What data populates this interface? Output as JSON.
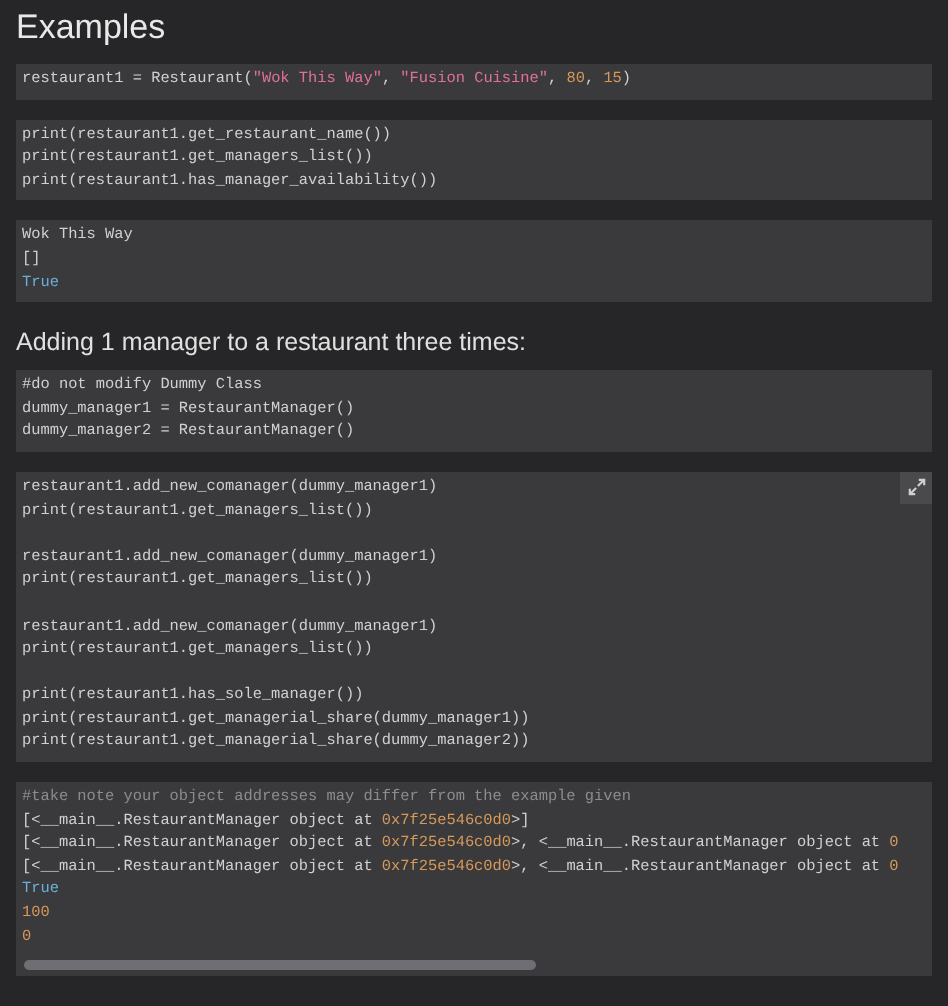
{
  "sections": [
    {
      "kind": "title",
      "text": "Examples"
    },
    {
      "kind": "code",
      "groups": [
        [
          [
            {
              "kind": "plain",
              "t": "restaurant1 = Restaurant("
            },
            {
              "kind": "str",
              "t": "\"Wok This Way\""
            },
            {
              "kind": "plain",
              "t": ", "
            },
            {
              "kind": "str",
              "t": "\"Fusion Cuisine\""
            },
            {
              "kind": "plain",
              "t": ", "
            },
            {
              "kind": "num",
              "t": "80"
            },
            {
              "kind": "plain",
              "t": ", "
            },
            {
              "kind": "num",
              "t": "15"
            },
            {
              "kind": "plain",
              "t": ")"
            }
          ]
        ]
      ]
    },
    {
      "kind": "code",
      "groups": [
        [
          [
            {
              "kind": "plain",
              "t": "print(restaurant1.get_restaurant_name())"
            }
          ],
          [
            {
              "kind": "plain",
              "t": "print(restaurant1.get_managers_list())"
            }
          ],
          [
            {
              "kind": "plain",
              "t": "print(restaurant1.has_manager_availability())"
            }
          ]
        ]
      ]
    },
    {
      "kind": "code",
      "groups": [
        [
          [
            {
              "kind": "plain",
              "t": "Wok This Way"
            }
          ],
          [
            {
              "kind": "plain",
              "t": "[]"
            }
          ],
          [
            {
              "kind": "bool",
              "t": "True"
            }
          ]
        ]
      ]
    },
    {
      "kind": "heading",
      "text": "Adding 1 manager to a restaurant three times:"
    },
    {
      "kind": "code",
      "groups": [
        [
          [
            {
              "kind": "plain",
              "t": "#do not modify Dummy Class"
            }
          ],
          [
            {
              "kind": "plain",
              "t": "dummy_manager1 = RestaurantManager()"
            }
          ],
          [
            {
              "kind": "plain",
              "t": "dummy_manager2 = RestaurantManager()"
            }
          ]
        ]
      ]
    },
    {
      "kind": "code",
      "expandable": true,
      "groups": [
        [
          [
            {
              "kind": "plain",
              "t": "restaurant1.add_new_comanager(dummy_manager1)"
            }
          ],
          [
            {
              "kind": "plain",
              "t": "print(restaurant1.get_managers_list())"
            }
          ]
        ],
        [
          [
            {
              "kind": "plain",
              "t": "restaurant1.add_new_comanager(dummy_manager1)"
            }
          ],
          [
            {
              "kind": "plain",
              "t": "print(restaurant1.get_managers_list())"
            }
          ]
        ],
        [
          [
            {
              "kind": "plain",
              "t": "restaurant1.add_new_comanager(dummy_manager1)"
            }
          ],
          [
            {
              "kind": "plain",
              "t": "print(restaurant1.get_managers_list())"
            }
          ]
        ],
        [
          [
            {
              "kind": "plain",
              "t": "print(restaurant1.has_sole_manager())"
            }
          ],
          [
            {
              "kind": "plain",
              "t": "print(restaurant1.get_managerial_share(dummy_manager1))"
            }
          ],
          [
            {
              "kind": "plain",
              "t": "print(restaurant1.get_managerial_share(dummy_manager2))"
            }
          ]
        ]
      ]
    },
    {
      "kind": "code",
      "scrollbar": true,
      "groups": [
        [
          [
            {
              "kind": "comment",
              "t": "#take note your object addresses may differ from the example given"
            }
          ],
          [
            {
              "kind": "plain",
              "t": "[<__main__.RestaurantManager object at "
            },
            {
              "kind": "num",
              "t": "0x7f25e546c0d0"
            },
            {
              "kind": "plain",
              "t": ">]"
            }
          ],
          [
            {
              "kind": "plain",
              "t": "[<__main__.RestaurantManager object at "
            },
            {
              "kind": "num",
              "t": "0x7f25e546c0d0"
            },
            {
              "kind": "plain",
              "t": ">, <__main__.RestaurantManager object at "
            },
            {
              "kind": "num",
              "t": "0"
            }
          ],
          [
            {
              "kind": "plain",
              "t": "[<__main__.RestaurantManager object at "
            },
            {
              "kind": "num",
              "t": "0x7f25e546c0d0"
            },
            {
              "kind": "plain",
              "t": ">, <__main__.RestaurantManager object at "
            },
            {
              "kind": "num",
              "t": "0"
            }
          ],
          [
            {
              "kind": "bool",
              "t": "True"
            }
          ],
          [
            {
              "kind": "num",
              "t": "100"
            }
          ],
          [
            {
              "kind": "num",
              "t": "0"
            }
          ]
        ]
      ]
    }
  ]
}
